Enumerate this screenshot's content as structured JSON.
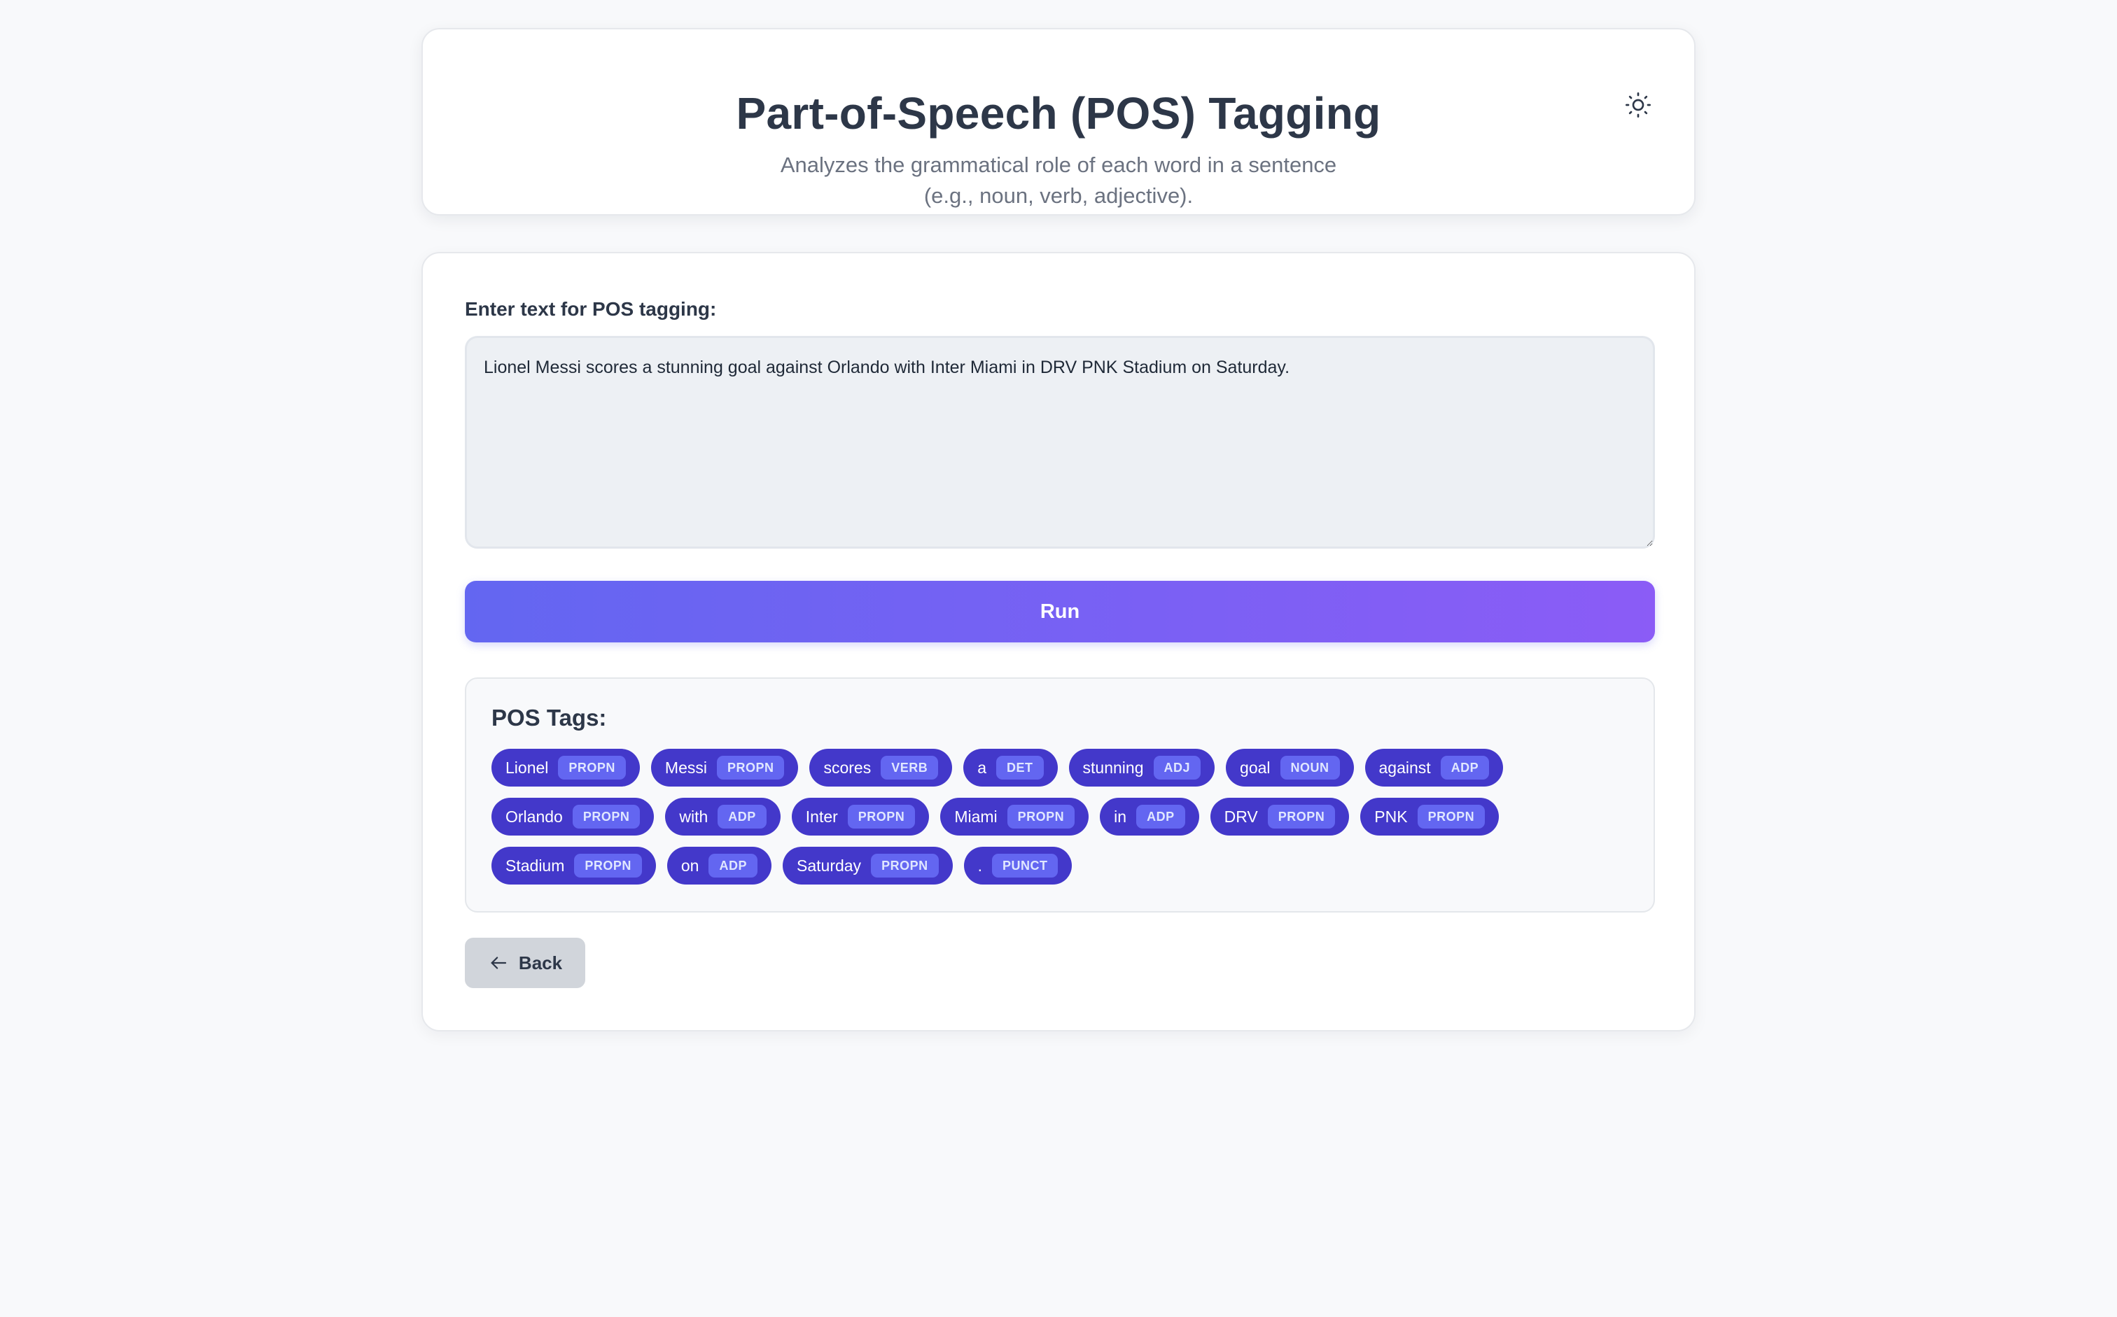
{
  "header": {
    "title": "Part-of-Speech (POS) Tagging",
    "subtitle_line1": "Analyzes the grammatical role of each word in a sentence",
    "subtitle_line2": "(e.g., noun, verb, adjective).",
    "theme_icon": "sun-icon"
  },
  "form": {
    "label": "Enter text for POS tagging:",
    "input_value": "Lionel Messi scores a stunning goal against Orlando with Inter Miami in DRV PNK Stadium on Saturday.",
    "run_label": "Run"
  },
  "results": {
    "title": "POS Tags:",
    "tokens": [
      {
        "word": "Lionel",
        "tag": "PROPN"
      },
      {
        "word": "Messi",
        "tag": "PROPN"
      },
      {
        "word": "scores",
        "tag": "VERB"
      },
      {
        "word": "a",
        "tag": "DET"
      },
      {
        "word": "stunning",
        "tag": "ADJ"
      },
      {
        "word": "goal",
        "tag": "NOUN"
      },
      {
        "word": "against",
        "tag": "ADP"
      },
      {
        "word": "Orlando",
        "tag": "PROPN"
      },
      {
        "word": "with",
        "tag": "ADP"
      },
      {
        "word": "Inter",
        "tag": "PROPN"
      },
      {
        "word": "Miami",
        "tag": "PROPN"
      },
      {
        "word": "in",
        "tag": "ADP"
      },
      {
        "word": "DRV",
        "tag": "PROPN"
      },
      {
        "word": "PNK",
        "tag": "PROPN"
      },
      {
        "word": "Stadium",
        "tag": "PROPN"
      },
      {
        "word": "on",
        "tag": "ADP"
      },
      {
        "word": "Saturday",
        "tag": "PROPN"
      },
      {
        "word": ".",
        "tag": "PUNCT"
      }
    ]
  },
  "nav": {
    "back_label": "Back",
    "back_icon": "arrow-left-icon"
  },
  "colors": {
    "accent_start": "#6366f1",
    "accent_end": "#8b5cf6",
    "token_bg": "#4338ca",
    "tag_bg": "#6366f1"
  }
}
